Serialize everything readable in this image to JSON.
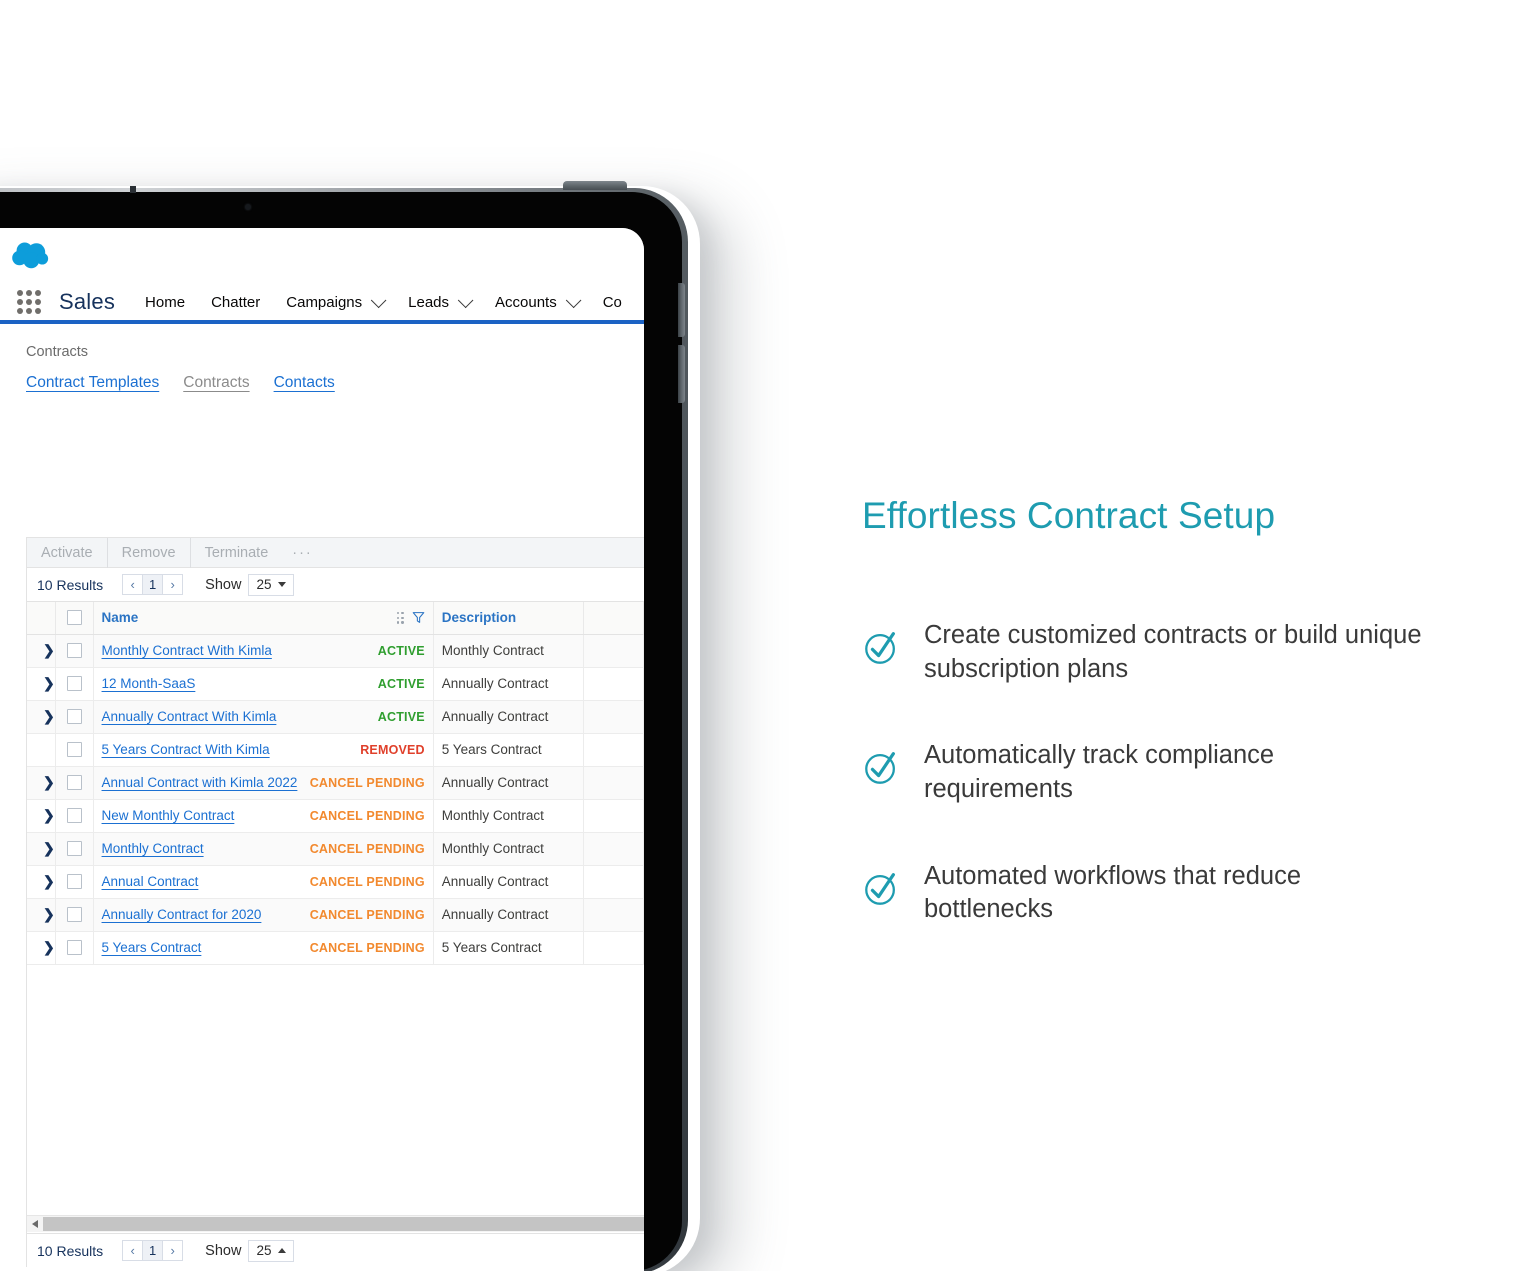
{
  "brand": {
    "accent_teal": "#1e9cb0",
    "salesforce_blue": "#00a1e0",
    "nav_underline": "#1b62c4",
    "link_blue": "#1b70d2"
  },
  "device": {
    "type": "tablet",
    "power_button": "power-button",
    "volume_buttons": [
      "volume-up",
      "volume-down"
    ],
    "camera": "front-camera"
  },
  "app": {
    "logo": "salesforce-cloud-logo",
    "launcher_icon": "app-launcher-grid-icon",
    "app_name": "Sales",
    "nav_items": [
      {
        "label": "Home",
        "has_dropdown": false
      },
      {
        "label": "Chatter",
        "has_dropdown": false
      },
      {
        "label": "Campaigns",
        "has_dropdown": true
      },
      {
        "label": "Leads",
        "has_dropdown": true
      },
      {
        "label": "Accounts",
        "has_dropdown": true
      },
      {
        "label": "Co",
        "has_dropdown": false
      }
    ]
  },
  "page": {
    "breadcrumb": "Contracts",
    "tabs": [
      {
        "label": "Contract Templates",
        "active": true
      },
      {
        "label": "Contracts",
        "active": false
      },
      {
        "label": "Contacts",
        "active": true
      }
    ]
  },
  "toolbar": {
    "actions": [
      "Activate",
      "Remove",
      "Terminate"
    ],
    "more_label": "···"
  },
  "pagination": {
    "results_label": "10 Results",
    "prev_label": "‹",
    "page_label": "1",
    "next_label": "›",
    "show_label": "Show",
    "page_size": "25"
  },
  "table": {
    "columns": [
      "Name",
      "Description"
    ],
    "header_icons": [
      "drag-handle-icon",
      "filter-icon"
    ],
    "rows": [
      {
        "expandable": true,
        "name": "Monthly Contract With Kimla",
        "status": "ACTIVE",
        "status_type": "active",
        "description": "Monthly Contract"
      },
      {
        "expandable": true,
        "name": "12 Month-SaaS",
        "status": "ACTIVE",
        "status_type": "active",
        "description": "Annually Contract"
      },
      {
        "expandable": true,
        "name": "Annually Contract With Kimla",
        "status": "ACTIVE",
        "status_type": "active",
        "description": "Annually Contract"
      },
      {
        "expandable": false,
        "name": "5 Years Contract With Kimla",
        "status": "REMOVED",
        "status_type": "removed",
        "description": "5 Years Contract"
      },
      {
        "expandable": true,
        "name": "Annual Contract with Kimla 2022",
        "status": "CANCEL PENDING",
        "status_type": "cancel",
        "description": "Annually Contract"
      },
      {
        "expandable": true,
        "name": "New Monthly Contract",
        "status": "CANCEL PENDING",
        "status_type": "cancel",
        "description": "Monthly Contract"
      },
      {
        "expandable": true,
        "name": "Monthly Contract",
        "status": "CANCEL PENDING",
        "status_type": "cancel",
        "description": "Monthly Contract"
      },
      {
        "expandable": true,
        "name": "Annual Contract",
        "status": "CANCEL PENDING",
        "status_type": "cancel",
        "description": "Annually Contract"
      },
      {
        "expandable": true,
        "name": "Annually Contract for 2020",
        "status": "CANCEL PENDING",
        "status_type": "cancel",
        "description": "Annually Contract"
      },
      {
        "expandable": true,
        "name": "5 Years Contract",
        "status": "CANCEL PENDING",
        "status_type": "cancel",
        "description": "5 Years Contract"
      }
    ]
  },
  "marketing": {
    "headline": "Effortless Contract Setup",
    "features": [
      "Create customized contracts or build unique subscription plans",
      "Automatically track compliance requirements",
      "Automated workflows that reduce bottlenecks"
    ]
  }
}
